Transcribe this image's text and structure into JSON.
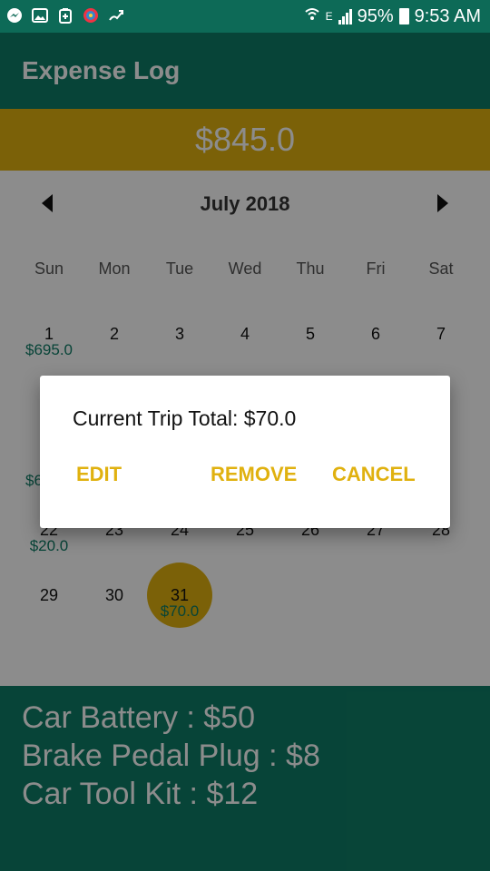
{
  "status_bar": {
    "battery": "95%",
    "time": "9:53 AM",
    "network": "E",
    "left_icons": [
      "messenger-icon",
      "gallery-icon",
      "battery-saver-icon",
      "colorful-app-icon",
      "upload-icon"
    ],
    "right_icons": [
      "wifi-icon",
      "signal-icon",
      "battery-icon"
    ]
  },
  "app_bar": {
    "title": "Expense Log"
  },
  "total": {
    "amount": "$845.0"
  },
  "calendar": {
    "month": "July 2018",
    "weekdays": [
      "Sun",
      "Mon",
      "Tue",
      "Wed",
      "Thu",
      "Fri",
      "Sat"
    ],
    "weeks": [
      [
        {
          "day": "1",
          "amount": "$695.0"
        },
        {
          "day": "2"
        },
        {
          "day": "3"
        },
        {
          "day": "4"
        },
        {
          "day": "5"
        },
        {
          "day": "6"
        },
        {
          "day": "7"
        }
      ],
      [
        {
          "day": "22",
          "amount": "$20.0"
        },
        {
          "day": "23"
        },
        {
          "day": "24"
        },
        {
          "day": "25"
        },
        {
          "day": "26"
        },
        {
          "day": "27"
        },
        {
          "day": "28"
        }
      ],
      [
        {
          "day": "29"
        },
        {
          "day": "30"
        },
        {
          "day": "31",
          "amount": "$70.0",
          "selected": true
        }
      ]
    ],
    "partial_amount": "$6"
  },
  "items": [
    "Car Battery : $50",
    "Brake Pedal Plug : $8",
    "Car Tool Kit : $12"
  ],
  "dialog": {
    "title": "Current Trip Total: $70.0",
    "buttons": {
      "edit": "EDIT",
      "remove": "REMOVE",
      "cancel": "CANCEL"
    }
  },
  "colors": {
    "primary": "#0e7d66",
    "primary_dark": "#0d6a57",
    "accent": "#e0b10f"
  }
}
